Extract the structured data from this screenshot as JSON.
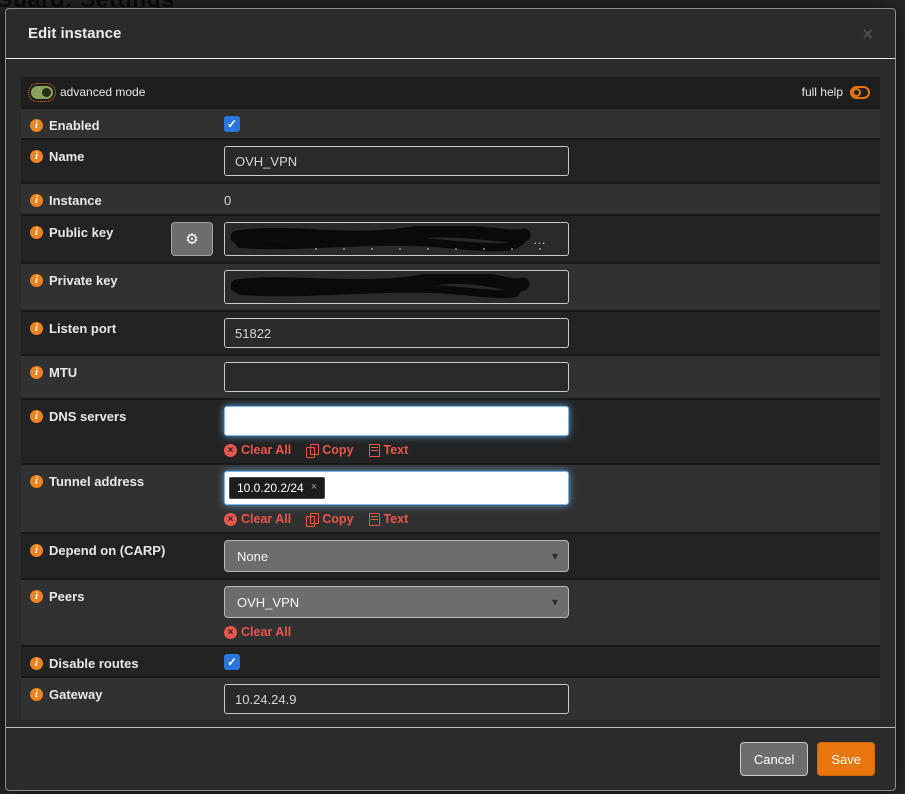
{
  "page": {
    "background_title": "WireGuard: Settings"
  },
  "modal": {
    "title": "Edit instance",
    "toolbar": {
      "advanced_mode": "advanced mode",
      "full_help": "full help"
    },
    "footer": {
      "cancel": "Cancel",
      "save": "Save"
    }
  },
  "icons": {
    "close": "×",
    "info": "i",
    "gear": "⚙",
    "caret": "▾",
    "check": "✓",
    "token_close": "×",
    "clear_x": "×",
    "redacted_ellipsis": "…"
  },
  "colors": {
    "accent_orange": "#e8750e",
    "link_red": "#e9564e",
    "checkbox_blue": "#2a76dd",
    "toggle_green": "#8aa35c",
    "save_button": "#e8750e"
  },
  "form": {
    "actions": {
      "clear_all": "Clear All",
      "copy": "Copy",
      "text": "Text"
    },
    "fields": {
      "enabled": {
        "label": "Enabled",
        "checked": true
      },
      "name": {
        "label": "Name",
        "value": "OVH_VPN"
      },
      "instance": {
        "label": "Instance",
        "value": "0"
      },
      "public_key": {
        "label": "Public key",
        "redacted": true
      },
      "private_key": {
        "label": "Private key",
        "redacted": true
      },
      "listen_port": {
        "label": "Listen port",
        "value": "51822"
      },
      "mtu": {
        "label": "MTU",
        "value": ""
      },
      "dns_servers": {
        "label": "DNS servers",
        "value": ""
      },
      "tunnel_address": {
        "label": "Tunnel address",
        "token": "10.0.20.2/24"
      },
      "depend_carp": {
        "label": "Depend on (CARP)",
        "selected": "None"
      },
      "peers": {
        "label": "Peers",
        "selected": "OVH_VPN"
      },
      "disable_routes": {
        "label": "Disable routes",
        "checked": true
      },
      "gateway": {
        "label": "Gateway",
        "value": "10.24.24.9"
      }
    }
  }
}
